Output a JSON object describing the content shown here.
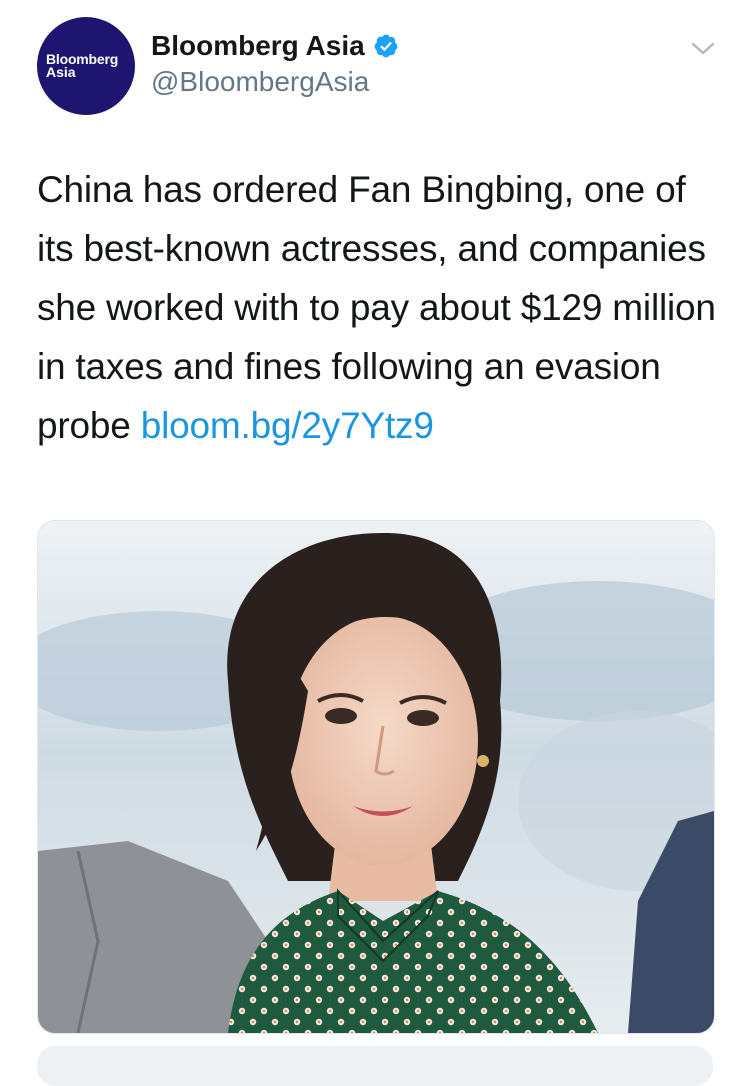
{
  "tweet": {
    "avatar": {
      "line1": "Bloomberg",
      "line2": "Asia"
    },
    "display_name": "Bloomberg Asia",
    "verified": true,
    "handle": "@BloombergAsia",
    "text": "China has ordered Fan Bingbing, one of its best-known actresses, and companies she worked with to pay about $129 million in taxes and fines following an evasion probe ",
    "link": "bloom.bg/2y7Ytz9",
    "media": {
      "icon": "photo-of-actress"
    }
  },
  "colors": {
    "link": "#1b95e0",
    "verified": "#1da1f2",
    "avatar_bg": "#1d1570",
    "handle": "#657786"
  }
}
